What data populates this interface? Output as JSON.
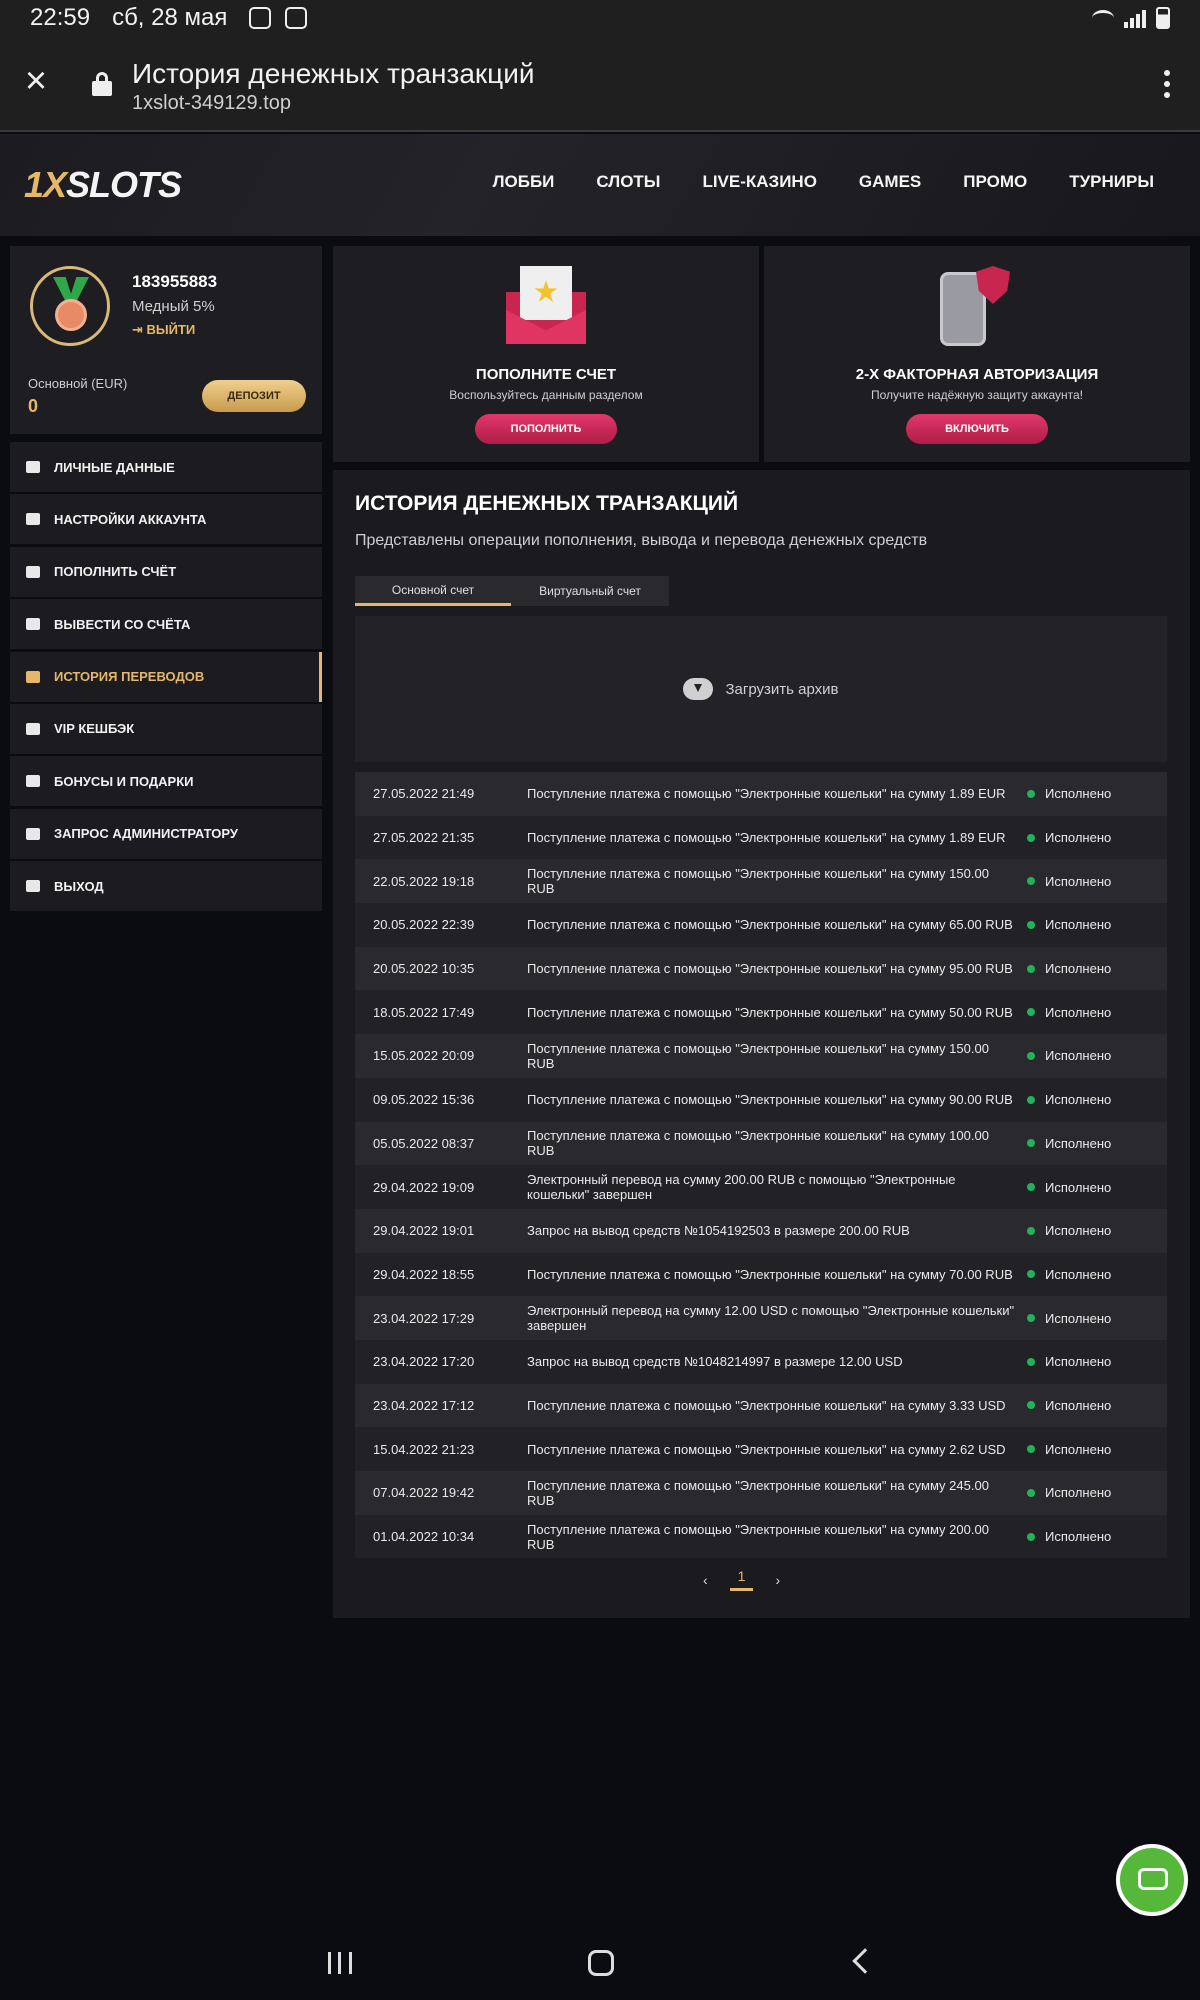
{
  "status_bar": {
    "time": "22:59",
    "date": "сб, 28 мая"
  },
  "browser": {
    "title": "История денежных транзакций",
    "url": "1xslot-349129.top"
  },
  "site": {
    "logo_prefix": "1X",
    "logo_suffix": "SLOTS",
    "nav": [
      "ЛОББИ",
      "СЛОТЫ",
      "LIVE-КАЗИНО",
      "GAMES",
      "ПРОМО",
      "ТУРНИРЫ"
    ]
  },
  "profile": {
    "user_id": "183955883",
    "rank": "Медный 5%",
    "logout": "ВЫЙТИ",
    "balance_label": "Основной (EUR)",
    "balance_value": "0",
    "deposit_label": "ДЕПОЗИТ"
  },
  "menu": [
    {
      "label": "ЛИЧНЫЕ ДАННЫЕ",
      "icon": "user-add-icon"
    },
    {
      "label": "НАСТРОЙКИ АККАУНТА",
      "icon": "gears-icon"
    },
    {
      "label": "ПОПОЛНИТЬ СЧЁТ",
      "icon": "download-icon"
    },
    {
      "label": "ВЫВЕСТИ СО СЧЁТА",
      "icon": "upload-icon"
    },
    {
      "label": "ИСТОРИЯ ПЕРЕВОДОВ",
      "icon": "transfer-arrows-icon",
      "active": true
    },
    {
      "label": "VIP КЕШБЭК",
      "icon": "crown-icon"
    },
    {
      "label": "БОНУСЫ И ПОДАРКИ",
      "icon": "gift-icon"
    },
    {
      "label": "ЗАПРОС АДМИНИСТРАТОРУ",
      "icon": "envelope-icon"
    },
    {
      "label": "ВЫХОД",
      "icon": "exit-icon"
    }
  ],
  "cards": {
    "deposit": {
      "title": "ПОПОЛНИТЕ СЧЕТ",
      "subtitle": "Воспользуйтесь данным разделом",
      "button": "ПОПОЛНИТЬ"
    },
    "twofa": {
      "title": "2-Х ФАКТОРНАЯ АВТОРИЗАЦИЯ",
      "subtitle": "Получите надёжную защиту аккаунта!",
      "button": "ВКЛЮЧИТЬ"
    }
  },
  "history": {
    "title": "ИСТОРИЯ ДЕНЕЖНЫХ ТРАНЗАКЦИЙ",
    "subtitle": "Представлены операции пополнения, вывода и перевода денежных средств",
    "tabs": [
      "Основной счет",
      "Виртуальный счет"
    ],
    "archive_label": "Загрузить архив",
    "rows": [
      {
        "date": "27.05.2022 21:49",
        "desc": "Поступление платежа с помощью \"Электронные кошельки\" на сумму 1.89 EUR",
        "status": "Исполнено"
      },
      {
        "date": "27.05.2022 21:35",
        "desc": "Поступление платежа с помощью \"Электронные кошельки\" на сумму 1.89 EUR",
        "status": "Исполнено"
      },
      {
        "date": "22.05.2022 19:18",
        "desc": "Поступление платежа с помощью \"Электронные кошельки\" на сумму 150.00 RUB",
        "status": "Исполнено"
      },
      {
        "date": "20.05.2022 22:39",
        "desc": "Поступление платежа с помощью \"Электронные кошельки\" на сумму 65.00 RUB",
        "status": "Исполнено"
      },
      {
        "date": "20.05.2022 10:35",
        "desc": "Поступление платежа с помощью \"Электронные кошельки\" на сумму 95.00 RUB",
        "status": "Исполнено"
      },
      {
        "date": "18.05.2022 17:49",
        "desc": "Поступление платежа с помощью \"Электронные кошельки\" на сумму 50.00 RUB",
        "status": "Исполнено"
      },
      {
        "date": "15.05.2022 20:09",
        "desc": "Поступление платежа с помощью \"Электронные кошельки\" на сумму 150.00 RUB",
        "status": "Исполнено"
      },
      {
        "date": "09.05.2022 15:36",
        "desc": "Поступление платежа с помощью \"Электронные кошельки\" на сумму 90.00 RUB",
        "status": "Исполнено"
      },
      {
        "date": "05.05.2022 08:37",
        "desc": "Поступление платежа с помощью \"Электронные кошельки\" на сумму 100.00 RUB",
        "status": "Исполнено"
      },
      {
        "date": "29.04.2022 19:09",
        "desc": "Электронный перевод на сумму 200.00 RUB с помощью \"Электронные кошельки\" завершен",
        "status": "Исполнено"
      },
      {
        "date": "29.04.2022 19:01",
        "desc": "Запрос на вывод средств №1054192503 в размере 200.00 RUB",
        "status": "Исполнено"
      },
      {
        "date": "29.04.2022 18:55",
        "desc": "Поступление платежа с помощью \"Электронные кошельки\" на сумму 70.00 RUB",
        "status": "Исполнено"
      },
      {
        "date": "23.04.2022 17:29",
        "desc": "Электронный перевод на сумму 12.00 USD с помощью \"Электронные кошельки\" завершен",
        "status": "Исполнено"
      },
      {
        "date": "23.04.2022 17:20",
        "desc": "Запрос на вывод средств №1048214997 в размере 12.00 USD",
        "status": "Исполнено"
      },
      {
        "date": "23.04.2022 17:12",
        "desc": "Поступление платежа с помощью \"Электронные кошельки\" на сумму 3.33 USD",
        "status": "Исполнено"
      },
      {
        "date": "15.04.2022 21:23",
        "desc": "Поступление платежа с помощью \"Электронные кошельки\" на сумму 2.62 USD",
        "status": "Исполнено"
      },
      {
        "date": "07.04.2022 19:42",
        "desc": "Поступление платежа с помощью \"Электронные кошельки\" на сумму 245.00 RUB",
        "status": "Исполнено"
      },
      {
        "date": "01.04.2022 10:34",
        "desc": "Поступление платежа с помощью \"Электронные кошельки\" на сумму 200.00 RUB",
        "status": "Исполнено"
      }
    ],
    "pager": {
      "prev": "‹",
      "page": "1",
      "next": "›"
    }
  },
  "colors": {
    "accent": "#e4b868",
    "brand_red": "#c8254f",
    "status_ok": "#21b35a",
    "chat": "#55b83a"
  }
}
